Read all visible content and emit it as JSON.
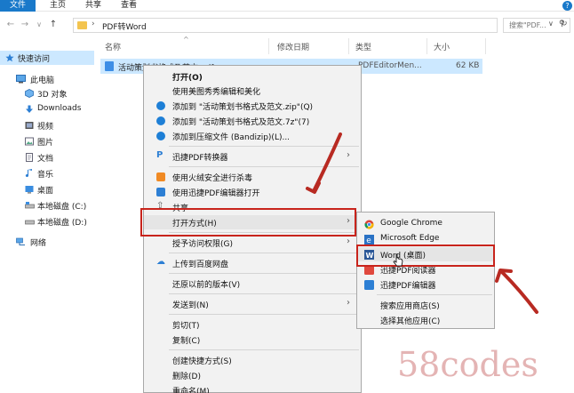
{
  "ribbon": {
    "tabs": [
      {
        "label": "文件"
      },
      {
        "label": "主页"
      },
      {
        "label": "共享"
      },
      {
        "label": "查看"
      }
    ],
    "help_icon": "?"
  },
  "nav": {
    "back_icon": "←",
    "forward_icon": "→",
    "recent_icon": "∨",
    "up_icon": "↑",
    "path_separator": "›",
    "path": "PDF转Word",
    "dropdown_icon": "∨",
    "refresh_icon": "↻",
    "search_placeholder": "搜索\"PDF...",
    "search_icon": "⚲"
  },
  "columns": {
    "name": "名称",
    "modified": "修改日期",
    "type": "类型",
    "size": "大小"
  },
  "sidebar": {
    "items": [
      {
        "label": "快速访问",
        "icon": "star-icon"
      },
      {
        "label": "此电脑",
        "icon": "computer-icon"
      },
      {
        "label": "3D 对象",
        "icon": "cube-icon"
      },
      {
        "label": "Downloads",
        "icon": "download-icon"
      },
      {
        "label": "视频",
        "icon": "video-icon"
      },
      {
        "label": "图片",
        "icon": "picture-icon"
      },
      {
        "label": "文档",
        "icon": "document-icon"
      },
      {
        "label": "音乐",
        "icon": "music-icon"
      },
      {
        "label": "桌面",
        "icon": "desktop-icon"
      },
      {
        "label": "本地磁盘 (C:)",
        "icon": "drive-icon"
      },
      {
        "label": "本地磁盘 (D:)",
        "icon": "drive-icon"
      },
      {
        "label": "网络",
        "icon": "network-icon"
      }
    ]
  },
  "file": {
    "name": "活动策划书格式及范文.pdf",
    "type": "PDFEditorMen...",
    "size": "62 KB"
  },
  "context_menu": {
    "items": [
      {
        "label": "打开(O)"
      },
      {
        "label": "使用美图秀秀编辑和美化"
      },
      {
        "label": "添加到 \"活动策划书格式及范文.zip\"(Q)"
      },
      {
        "label": "添加到 \"活动策划书格式及范文.7z\"(7)"
      },
      {
        "label": "添加到压缩文件 (Bandizip)(L)..."
      },
      {
        "label": "迅捷PDF转换器"
      },
      {
        "label": "使用火绒安全进行杀毒"
      },
      {
        "label": "使用迅捷PDF编辑器打开"
      },
      {
        "label": "共享"
      },
      {
        "label": "打开方式(H)"
      },
      {
        "label": "授予访问权限(G)"
      },
      {
        "label": "上传到百度网盘"
      },
      {
        "label": "还原以前的版本(V)"
      },
      {
        "label": "发送到(N)"
      },
      {
        "label": "剪切(T)"
      },
      {
        "label": "复制(C)"
      },
      {
        "label": "创建快捷方式(S)"
      },
      {
        "label": "删除(D)"
      },
      {
        "label": "重命名(M)"
      }
    ],
    "submenu_arrow": "›"
  },
  "open_with_submenu": {
    "items": [
      {
        "label": "Google Chrome"
      },
      {
        "label": "Microsoft Edge"
      },
      {
        "label": "Word (桌面)"
      },
      {
        "label": "迅捷PDF阅读器"
      },
      {
        "label": "迅捷PDF编辑器"
      },
      {
        "label": "搜索应用商店(S)"
      },
      {
        "label": "选择其他应用(C)"
      }
    ]
  },
  "watermark": "58codes",
  "colors": {
    "accent": "#1979ca",
    "selection": "#cce8ff",
    "highlight_red": "#c8241c"
  }
}
